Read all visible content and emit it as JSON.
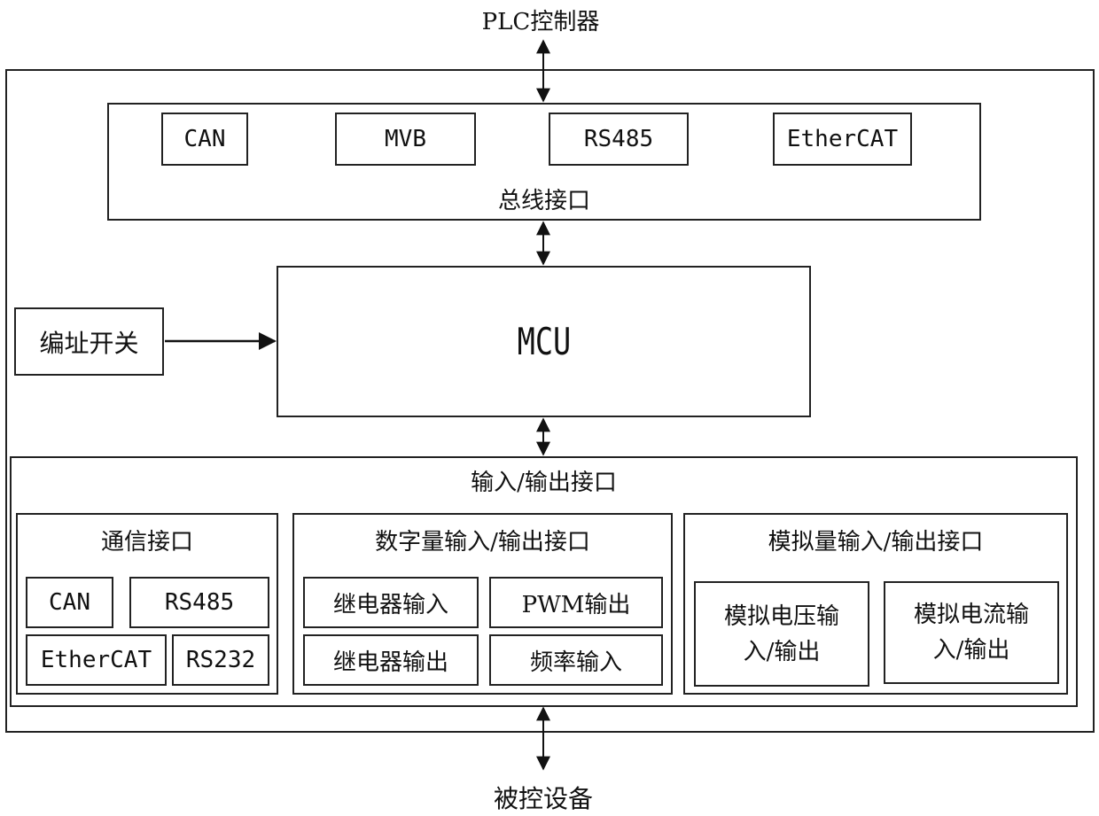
{
  "top_node": "PLC控制器",
  "bottom_node": "被控设备",
  "bus_interface": {
    "label": "总线接口",
    "items": [
      "CAN",
      "MVB",
      "RS485",
      "EtherCAT"
    ]
  },
  "mcu": {
    "label": "MCU"
  },
  "address_switch": {
    "label": "编址开关"
  },
  "io_interface": {
    "label": "输入/输出接口",
    "comm": {
      "label": "通信接口",
      "items": [
        "CAN",
        "RS485",
        "EtherCAT",
        "RS232"
      ]
    },
    "digital": {
      "label": "数字量输入/输出接口",
      "items": [
        "继电器输入",
        "PWM输出",
        "继电器输出",
        "频率输入"
      ]
    },
    "analog": {
      "label": "模拟量输入/输出接口",
      "items": [
        {
          "line1": "模拟电压输",
          "line2": "入/输出"
        },
        {
          "line1": "模拟电流输",
          "line2": "入/输出"
        }
      ]
    }
  }
}
